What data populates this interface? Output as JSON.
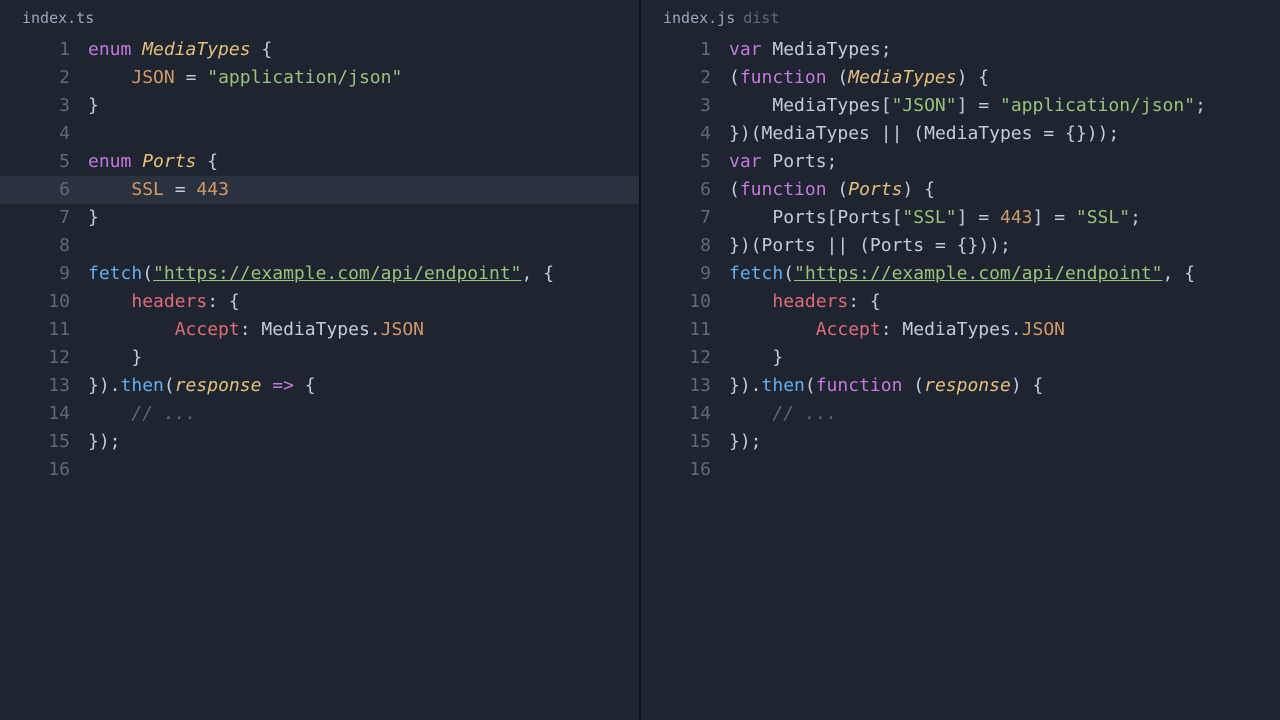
{
  "left": {
    "tab": {
      "name": "index.ts",
      "sub": ""
    },
    "highlight_line": 6,
    "lines": [
      {
        "n": 1,
        "tokens": [
          [
            "kw",
            "enum"
          ],
          [
            "sp",
            " "
          ],
          [
            "type",
            "MediaTypes"
          ],
          [
            "sp",
            " "
          ],
          [
            "punc",
            "{"
          ]
        ]
      },
      {
        "n": 2,
        "tokens": [
          [
            "sp",
            "    "
          ],
          [
            "const",
            "JSON"
          ],
          [
            "sp",
            " "
          ],
          [
            "punc",
            "="
          ],
          [
            "sp",
            " "
          ],
          [
            "str",
            "\"application/json\""
          ]
        ]
      },
      {
        "n": 3,
        "tokens": [
          [
            "punc",
            "}"
          ]
        ]
      },
      {
        "n": 4,
        "tokens": []
      },
      {
        "n": 5,
        "tokens": [
          [
            "kw",
            "enum"
          ],
          [
            "sp",
            " "
          ],
          [
            "type",
            "Ports"
          ],
          [
            "sp",
            " "
          ],
          [
            "punc",
            "{"
          ]
        ]
      },
      {
        "n": 6,
        "tokens": [
          [
            "sp",
            "    "
          ],
          [
            "const",
            "SSL"
          ],
          [
            "sp",
            " "
          ],
          [
            "punc",
            "="
          ],
          [
            "sp",
            " "
          ],
          [
            "num",
            "443"
          ]
        ]
      },
      {
        "n": 7,
        "tokens": [
          [
            "punc",
            "}"
          ]
        ]
      },
      {
        "n": 8,
        "tokens": []
      },
      {
        "n": 9,
        "tokens": [
          [
            "fn",
            "fetch"
          ],
          [
            "punc",
            "("
          ],
          [
            "stru",
            "\"https://example.com/api/endpoint\""
          ],
          [
            "punc",
            ","
          ],
          [
            "sp",
            " "
          ],
          [
            "punc",
            "{"
          ]
        ]
      },
      {
        "n": 10,
        "tokens": [
          [
            "sp",
            "    "
          ],
          [
            "prop",
            "headers"
          ],
          [
            "punc",
            ":"
          ],
          [
            "sp",
            " "
          ],
          [
            "punc",
            "{"
          ]
        ]
      },
      {
        "n": 11,
        "tokens": [
          [
            "sp",
            "        "
          ],
          [
            "prop",
            "Accept"
          ],
          [
            "punc",
            ":"
          ],
          [
            "sp",
            " "
          ],
          [
            "ident",
            "MediaTypes"
          ],
          [
            "dot",
            "."
          ],
          [
            "const",
            "JSON"
          ]
        ]
      },
      {
        "n": 12,
        "tokens": [
          [
            "sp",
            "    "
          ],
          [
            "punc",
            "}"
          ]
        ]
      },
      {
        "n": 13,
        "tokens": [
          [
            "punc",
            "})."
          ],
          [
            "fn",
            "then"
          ],
          [
            "punc",
            "("
          ],
          [
            "param",
            "response"
          ],
          [
            "sp",
            " "
          ],
          [
            "arrow",
            "=>"
          ],
          [
            "sp",
            " "
          ],
          [
            "punc",
            "{"
          ]
        ]
      },
      {
        "n": 14,
        "tokens": [
          [
            "sp",
            "    "
          ],
          [
            "cmt",
            "// ..."
          ]
        ]
      },
      {
        "n": 15,
        "tokens": [
          [
            "punc",
            "});"
          ]
        ]
      },
      {
        "n": 16,
        "tokens": []
      }
    ]
  },
  "right": {
    "tab": {
      "name": "index.js",
      "sub": "dist"
    },
    "highlight_line": null,
    "lines": [
      {
        "n": 1,
        "tokens": [
          [
            "kw",
            "var"
          ],
          [
            "sp",
            " "
          ],
          [
            "ident",
            "MediaTypes"
          ],
          [
            "punc",
            ";"
          ]
        ]
      },
      {
        "n": 2,
        "tokens": [
          [
            "punc",
            "("
          ],
          [
            "kw",
            "function"
          ],
          [
            "sp",
            " "
          ],
          [
            "punc",
            "("
          ],
          [
            "param",
            "MediaTypes"
          ],
          [
            "punc",
            ")"
          ],
          [
            "sp",
            " "
          ],
          [
            "punc",
            "{"
          ]
        ]
      },
      {
        "n": 3,
        "tokens": [
          [
            "sp",
            "    "
          ],
          [
            "ident",
            "MediaTypes"
          ],
          [
            "punc",
            "["
          ],
          [
            "str",
            "\"JSON\""
          ],
          [
            "punc",
            "]"
          ],
          [
            "sp",
            " "
          ],
          [
            "punc",
            "="
          ],
          [
            "sp",
            " "
          ],
          [
            "str",
            "\"application/json\""
          ],
          [
            "punc",
            ";"
          ]
        ]
      },
      {
        "n": 4,
        "tokens": [
          [
            "punc",
            "})("
          ],
          [
            "ident",
            "MediaTypes"
          ],
          [
            "sp",
            " "
          ],
          [
            "punc",
            "||"
          ],
          [
            "sp",
            " "
          ],
          [
            "punc",
            "("
          ],
          [
            "ident",
            "MediaTypes"
          ],
          [
            "sp",
            " "
          ],
          [
            "punc",
            "="
          ],
          [
            "sp",
            " "
          ],
          [
            "punc",
            "{}));"
          ]
        ]
      },
      {
        "n": 5,
        "tokens": [
          [
            "kw",
            "var"
          ],
          [
            "sp",
            " "
          ],
          [
            "ident",
            "Ports"
          ],
          [
            "punc",
            ";"
          ]
        ]
      },
      {
        "n": 6,
        "tokens": [
          [
            "punc",
            "("
          ],
          [
            "kw",
            "function"
          ],
          [
            "sp",
            " "
          ],
          [
            "punc",
            "("
          ],
          [
            "param",
            "Ports"
          ],
          [
            "punc",
            ")"
          ],
          [
            "sp",
            " "
          ],
          [
            "punc",
            "{"
          ]
        ]
      },
      {
        "n": 7,
        "tokens": [
          [
            "sp",
            "    "
          ],
          [
            "ident",
            "Ports"
          ],
          [
            "punc",
            "["
          ],
          [
            "ident",
            "Ports"
          ],
          [
            "punc",
            "["
          ],
          [
            "str",
            "\"SSL\""
          ],
          [
            "punc",
            "]"
          ],
          [
            "sp",
            " "
          ],
          [
            "punc",
            "="
          ],
          [
            "sp",
            " "
          ],
          [
            "num",
            "443"
          ],
          [
            "punc",
            "]"
          ],
          [
            "sp",
            " "
          ],
          [
            "punc",
            "="
          ],
          [
            "sp",
            " "
          ],
          [
            "str",
            "\"SSL\""
          ],
          [
            "punc",
            ";"
          ]
        ]
      },
      {
        "n": 8,
        "tokens": [
          [
            "punc",
            "})("
          ],
          [
            "ident",
            "Ports"
          ],
          [
            "sp",
            " "
          ],
          [
            "punc",
            "||"
          ],
          [
            "sp",
            " "
          ],
          [
            "punc",
            "("
          ],
          [
            "ident",
            "Ports"
          ],
          [
            "sp",
            " "
          ],
          [
            "punc",
            "="
          ],
          [
            "sp",
            " "
          ],
          [
            "punc",
            "{}));"
          ]
        ]
      },
      {
        "n": 9,
        "tokens": [
          [
            "fn",
            "fetch"
          ],
          [
            "punc",
            "("
          ],
          [
            "stru",
            "\"https://example.com/api/endpoint\""
          ],
          [
            "punc",
            ","
          ],
          [
            "sp",
            " "
          ],
          [
            "punc",
            "{"
          ]
        ]
      },
      {
        "n": 10,
        "tokens": [
          [
            "sp",
            "    "
          ],
          [
            "prop",
            "headers"
          ],
          [
            "punc",
            ":"
          ],
          [
            "sp",
            " "
          ],
          [
            "punc",
            "{"
          ]
        ]
      },
      {
        "n": 11,
        "tokens": [
          [
            "sp",
            "        "
          ],
          [
            "prop",
            "Accept"
          ],
          [
            "punc",
            ":"
          ],
          [
            "sp",
            " "
          ],
          [
            "ident",
            "MediaTypes"
          ],
          [
            "dot",
            "."
          ],
          [
            "const",
            "JSON"
          ]
        ]
      },
      {
        "n": 12,
        "tokens": [
          [
            "sp",
            "    "
          ],
          [
            "punc",
            "}"
          ]
        ]
      },
      {
        "n": 13,
        "tokens": [
          [
            "punc",
            "})."
          ],
          [
            "fn",
            "then"
          ],
          [
            "punc",
            "("
          ],
          [
            "kw",
            "function"
          ],
          [
            "sp",
            " "
          ],
          [
            "punc",
            "("
          ],
          [
            "param",
            "response"
          ],
          [
            "punc",
            ")"
          ],
          [
            "sp",
            " "
          ],
          [
            "punc",
            "{"
          ]
        ]
      },
      {
        "n": 14,
        "tokens": [
          [
            "sp",
            "    "
          ],
          [
            "cmt",
            "// ..."
          ]
        ]
      },
      {
        "n": 15,
        "tokens": [
          [
            "punc",
            "});"
          ]
        ]
      },
      {
        "n": 16,
        "tokens": []
      }
    ]
  }
}
